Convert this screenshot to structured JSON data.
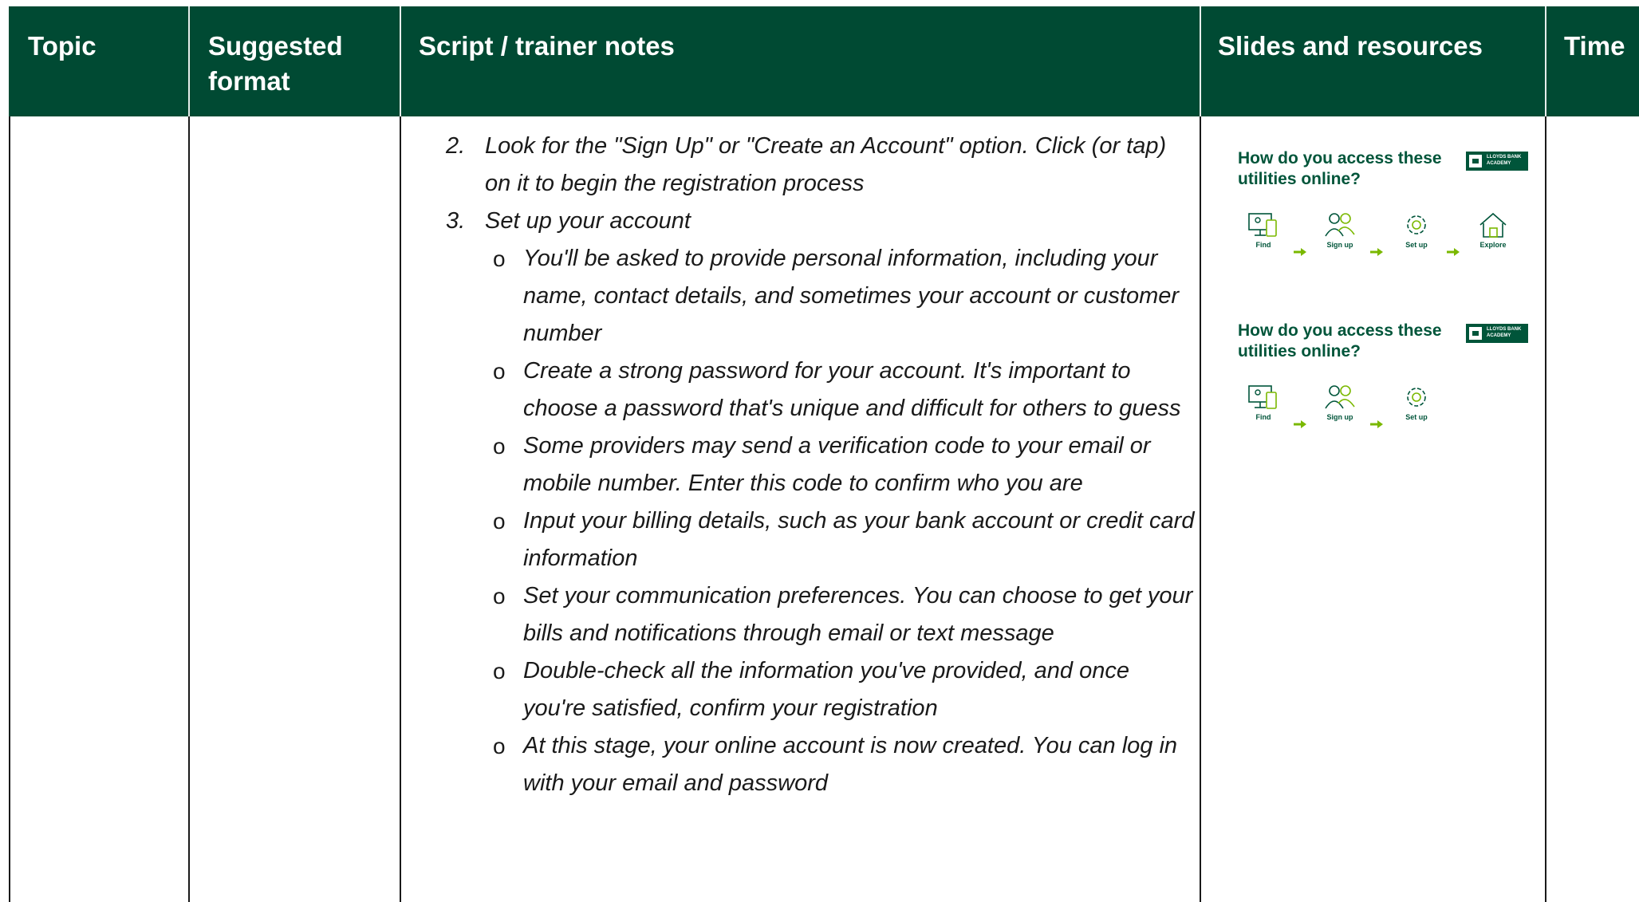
{
  "table": {
    "headers": {
      "topic": "Topic",
      "format": "Suggested\nformat",
      "script": "Script / trainer notes",
      "slides": "Slides and resources",
      "time": "Time"
    }
  },
  "notes": {
    "steps": [
      {
        "num": "2.",
        "text": "Look for the \"Sign Up\" or \"Create an Account\" option. Click (or tap) on it to begin the registration process",
        "subs": []
      },
      {
        "num": "3.",
        "text": "Set up your account",
        "subs": [
          "You'll be asked to provide personal information, including your name, contact details, and sometimes your account or customer number",
          "Create a strong password for your account. It's important to choose a password that's unique and difficult for others to guess",
          "Some providers may send a verification code to your email or mobile number. Enter this code to confirm who you are",
          "Input your billing details, such as your bank account or credit card information",
          "Set your communication preferences. You can choose to get your bills and notifications through email or text message",
          "Double-check all the information you've provided, and once you're satisfied, confirm your registration",
          "At this stage, your online account is now created. You can log in with your email and password"
        ]
      }
    ],
    "bullet_glyph": "o"
  },
  "slides": [
    {
      "title": "How do you access these utilities online?",
      "badge_text": "LLOYDS BANK ACADEMY",
      "steps": [
        {
          "icon": "device-icon",
          "label": "Find"
        },
        {
          "icon": "people-icon",
          "label": "Sign up"
        },
        {
          "icon": "gear-icon",
          "label": "Set up"
        },
        {
          "icon": "house-icon",
          "label": "Explore"
        }
      ]
    },
    {
      "title": "How do you access these utilities online?",
      "badge_text": "LLOYDS BANK ACADEMY",
      "steps": [
        {
          "icon": "device-icon",
          "label": "Find"
        },
        {
          "icon": "people-icon",
          "label": "Sign up"
        },
        {
          "icon": "gear-icon",
          "label": "Set up"
        }
      ]
    }
  ],
  "colors": {
    "header_bg": "#004a33",
    "brand_green": "#00553a",
    "arrow_green": "#7ab800"
  }
}
